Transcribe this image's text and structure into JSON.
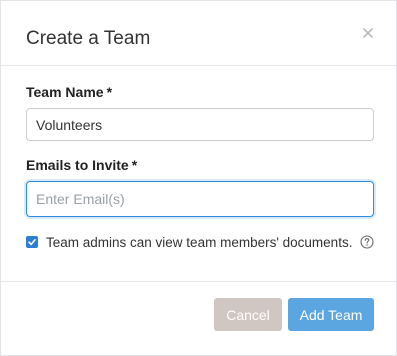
{
  "dialog": {
    "title": "Create a Team",
    "close_icon": "close-icon"
  },
  "form": {
    "team_name": {
      "label": "Team Name",
      "required_mark": "*",
      "value": "Volunteers"
    },
    "emails": {
      "label": "Emails to Invite",
      "required_mark": "*",
      "placeholder": "Enter Email(s)",
      "value": ""
    },
    "admin_view": {
      "checked": true,
      "label": "Team admins can view team members' documents.",
      "help_icon": "question-circle-icon"
    }
  },
  "footer": {
    "cancel_label": "Cancel",
    "add_label": "Add Team"
  },
  "colors": {
    "accent": "#2d7fd3",
    "focus_border": "#2d8cdb",
    "add_button": "#5ba6e0",
    "cancel_button": "#d1c7c2"
  }
}
